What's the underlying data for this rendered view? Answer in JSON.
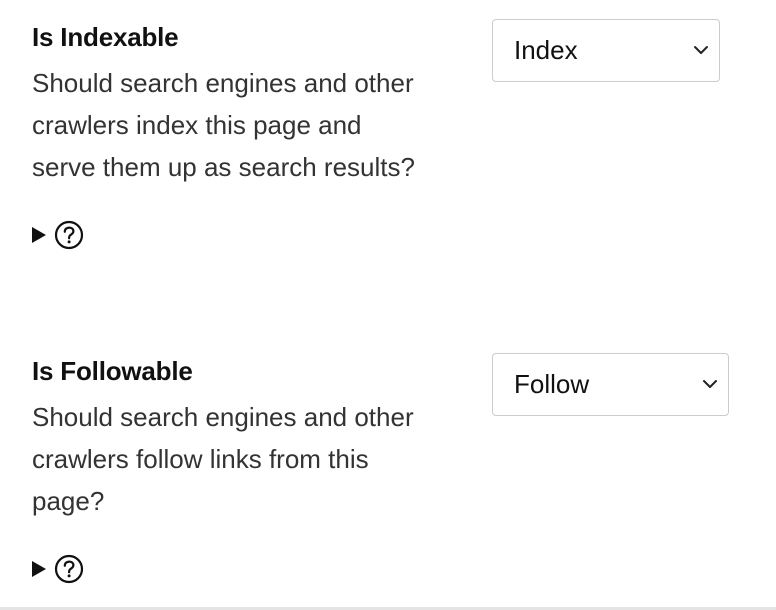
{
  "fields": {
    "indexable": {
      "label": "Is Indexable",
      "help_lines": [
        "Should search engines and other",
        "crawlers index this page and",
        "serve them up as search results?"
      ],
      "select_value": "Index",
      "details_icon": "help-circle-icon"
    },
    "followable": {
      "label": "Is Followable",
      "help_lines": [
        "Should search engines and other",
        "crawlers follow links from this",
        "page?"
      ],
      "select_value": "Follow",
      "details_icon": "help-circle-icon"
    }
  },
  "colors": {
    "text": "#222222",
    "label": "#111111",
    "border": "#cccccc"
  }
}
